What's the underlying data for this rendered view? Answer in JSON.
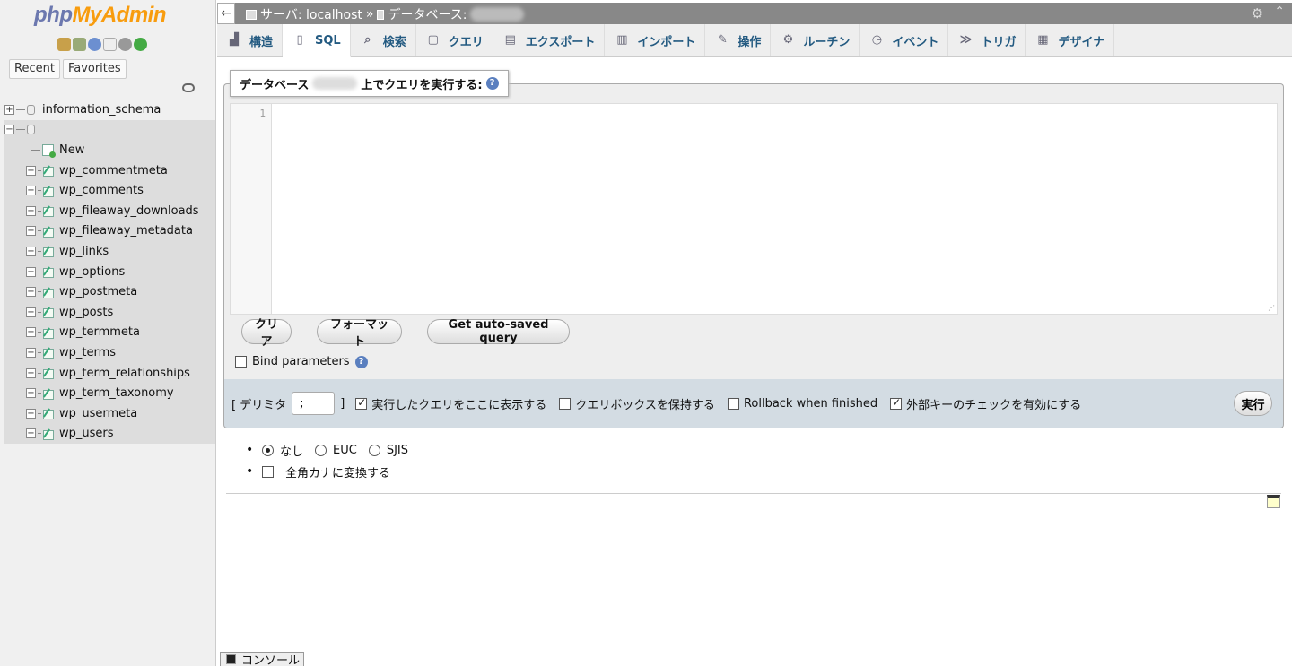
{
  "logo": {
    "part1": "php",
    "part2": "MyAdmin"
  },
  "nav": {
    "tabs": [
      "Recent",
      "Favorites"
    ],
    "databases": [
      {
        "name": "information_schema",
        "expanded": false
      },
      {
        "name": "",
        "expanded": true
      }
    ],
    "new_label": "New",
    "tables": [
      "wp_commentmeta",
      "wp_comments",
      "wp_fileaway_downloads",
      "wp_fileaway_metadata",
      "wp_links",
      "wp_options",
      "wp_postmeta",
      "wp_posts",
      "wp_termmeta",
      "wp_terms",
      "wp_term_relationships",
      "wp_term_taxonomy",
      "wp_usermeta",
      "wp_users"
    ]
  },
  "breadcrumb": {
    "back": "←",
    "server_label": "サーバ: localhost",
    "sep": "»",
    "db_label": "データベース:"
  },
  "tabs": [
    {
      "label": "構造",
      "icon": "structure-icon",
      "glyph": "▟",
      "active": false
    },
    {
      "label": "SQL",
      "icon": "sql-icon",
      "glyph": "▯",
      "active": true
    },
    {
      "label": "検索",
      "icon": "search-icon",
      "glyph": "⌕",
      "active": false
    },
    {
      "label": "クエリ",
      "icon": "query-icon",
      "glyph": "▢",
      "active": false
    },
    {
      "label": "エクスポート",
      "icon": "export-icon",
      "glyph": "▤",
      "active": false
    },
    {
      "label": "インポート",
      "icon": "import-icon",
      "glyph": "▥",
      "active": false
    },
    {
      "label": "操作",
      "icon": "operations-icon",
      "glyph": "✎",
      "active": false
    },
    {
      "label": "ルーチン",
      "icon": "routines-icon",
      "glyph": "⚙",
      "active": false
    },
    {
      "label": "イベント",
      "icon": "events-icon",
      "glyph": "◷",
      "active": false
    },
    {
      "label": "トリガ",
      "icon": "triggers-icon",
      "glyph": "≫",
      "active": false
    },
    {
      "label": "デザイナ",
      "icon": "designer-icon",
      "glyph": "▦",
      "active": false
    }
  ],
  "sql": {
    "legend_prefix": "データベース",
    "legend_suffix": "上でクエリを実行する:",
    "line_number": "1",
    "query": "",
    "buttons": {
      "clear": "クリア",
      "format": "フォーマット",
      "autosave": "Get auto-saved query"
    },
    "bind_parameters": "Bind parameters"
  },
  "options": {
    "delimiter_label_open": "[ デリミタ",
    "delimiter_value": ";",
    "delimiter_label_close": "]",
    "show_query": {
      "label": "実行したクエリをここに表示する",
      "checked": true
    },
    "retain_box": {
      "label": "クエリボックスを保持する",
      "checked": false
    },
    "rollback": {
      "label": "Rollback when finished",
      "checked": false
    },
    "fk_checks": {
      "label": "外部キーのチェックを有効にする",
      "checked": true
    },
    "go": "実行"
  },
  "encoding": {
    "options": [
      {
        "label": "なし",
        "selected": true
      },
      {
        "label": "EUC",
        "selected": false
      },
      {
        "label": "SJIS",
        "selected": false
      }
    ],
    "kana_label": "全角カナに変換する"
  },
  "console": {
    "label": "コンソール"
  },
  "colors": {
    "brand_blue": "#6c78af",
    "brand_orange": "#f89c0e",
    "tab_text": "#235a81",
    "options_bg": "#d3dce3"
  }
}
